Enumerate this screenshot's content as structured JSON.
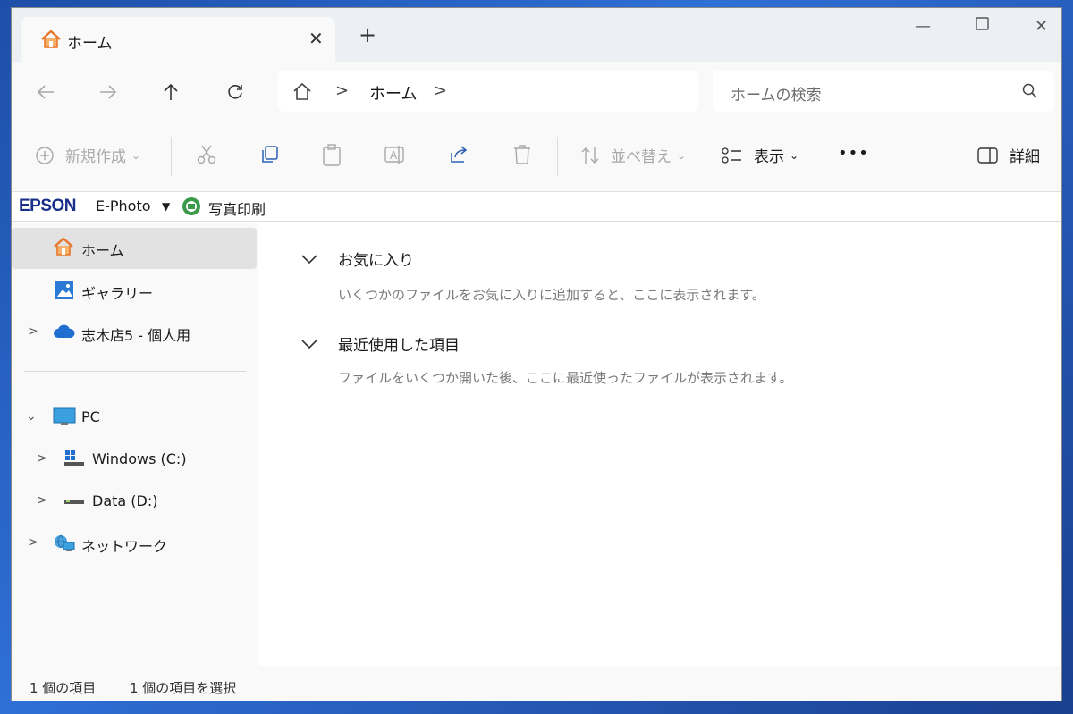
{
  "tab": {
    "title": "ホーム"
  },
  "nav": {
    "breadcrumb": [
      "ホーム"
    ],
    "search_placeholder": "ホームの検索"
  },
  "toolbar": {
    "new_label": "新規作成",
    "sort_label": "並べ替え",
    "view_label": "表示",
    "more_label": "•••",
    "details_label": "詳細"
  },
  "epson_bar": {
    "brand": "EPSON",
    "app": "E-Photo",
    "print_label": "写真印刷"
  },
  "sidebar": {
    "items": [
      {
        "label": "ホーム",
        "icon": "home-icon",
        "selected": true
      },
      {
        "label": "ギャラリー",
        "icon": "gallery-icon"
      },
      {
        "label": "志木店5 - 個人用",
        "icon": "onedrive-cloud-icon"
      },
      {
        "label": "PC",
        "icon": "pc-monitor-icon",
        "expanded": true
      },
      {
        "label": "Windows (C:)",
        "icon": "windows-drive-icon"
      },
      {
        "label": "Data (D:)",
        "icon": "drive-icon"
      },
      {
        "label": "ネットワーク",
        "icon": "network-icon"
      }
    ]
  },
  "main": {
    "sections": [
      {
        "title": "お気に入り",
        "description": "いくつかのファイルをお気に入りに追加すると、ここに表示されます。"
      },
      {
        "title": "最近使用した項目",
        "description": "ファイルをいくつか開いた後、ここに最近使ったファイルが表示されます。"
      }
    ]
  },
  "status": {
    "item_count": "1 個の項目",
    "selected_count": "1 個の項目を選択"
  },
  "colors": {
    "accent": "#1a2f8a",
    "selected_bg": "#e2e2e2",
    "home_orange": "#e8762b"
  }
}
